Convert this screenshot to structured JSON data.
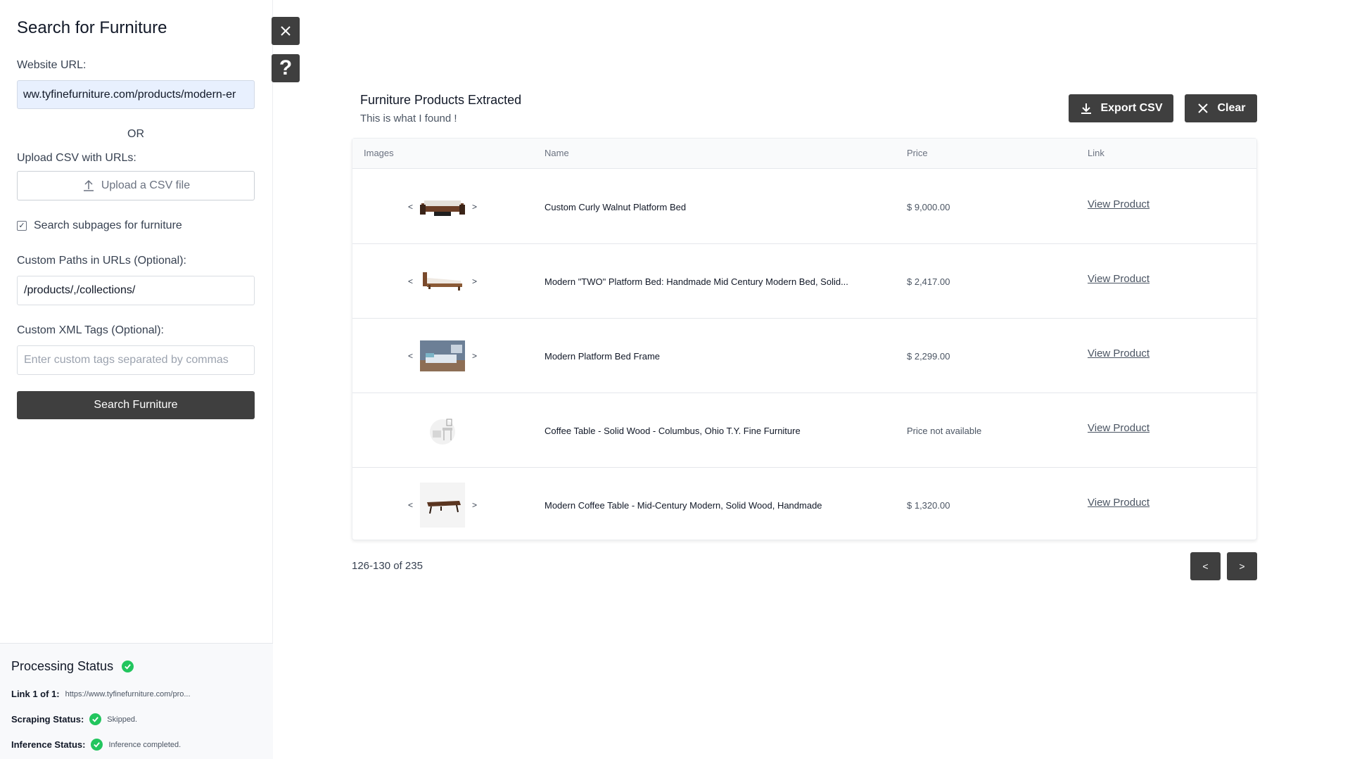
{
  "sidebar": {
    "title": "Search for Furniture",
    "website_url_label": "Website URL:",
    "website_url_value": "ww.tyfinefurniture.com/products/modern-er",
    "or_label": "OR",
    "upload_label": "Upload CSV with URLs:",
    "upload_button": "Upload a CSV file",
    "subpages_label": "Search subpages for furniture",
    "subpages_checked": true,
    "custom_paths_label": "Custom Paths in URLs (Optional):",
    "custom_paths_value": "/products/,/collections/",
    "custom_xml_label": "Custom XML Tags (Optional):",
    "custom_xml_placeholder": "Enter custom tags separated by commas",
    "search_button": "Search Furniture"
  },
  "status": {
    "title": "Processing Status",
    "link_label": "Link 1 of 1:",
    "link_value": "https://www.tyfinefurniture.com/pro...",
    "scraping_label": "Scraping Status:",
    "scraping_value": "Skipped.",
    "inference_label": "Inference Status:",
    "inference_value": "Inference completed."
  },
  "side_buttons": {
    "close_icon": "close-icon",
    "help_label": "?"
  },
  "main": {
    "title": "Furniture Products Extracted",
    "subtitle": "This is what I found !",
    "export_button": "Export CSV",
    "clear_button": "Clear",
    "columns": [
      "Images",
      "Name",
      "Price",
      "Link"
    ],
    "rows": [
      {
        "name": "Custom Curly Walnut Platform Bed",
        "price": "$ 9,000.00",
        "link": "View Product",
        "thumb": "bed-dark",
        "has_arrows": true
      },
      {
        "name": "Modern \"TWO\" Platform Bed: Handmade Mid Century Modern Bed, Solid...",
        "price": "$ 2,417.00",
        "link": "View Product",
        "thumb": "bed-light",
        "has_arrows": true
      },
      {
        "name": "Modern Platform Bed Frame",
        "price": "$ 2,299.00",
        "link": "View Product",
        "thumb": "bedroom-photo",
        "has_arrows": true
      },
      {
        "name": "Coffee Table - Solid Wood - Columbus, Ohio T.Y. Fine Furniture",
        "price": "Price not available",
        "link": "View Product",
        "thumb": "placeholder-furniture",
        "has_arrows": false
      },
      {
        "name": "Modern Coffee Table - Mid-Century Modern, Solid Wood, Handmade",
        "price": "$ 1,320.00",
        "link": "View Product",
        "thumb": "coffee-table",
        "has_arrows": true
      }
    ],
    "arrow_left": "<",
    "arrow_right": ">",
    "pager_info": "126-130 of 235",
    "pager_prev": "<",
    "pager_next": ">"
  }
}
